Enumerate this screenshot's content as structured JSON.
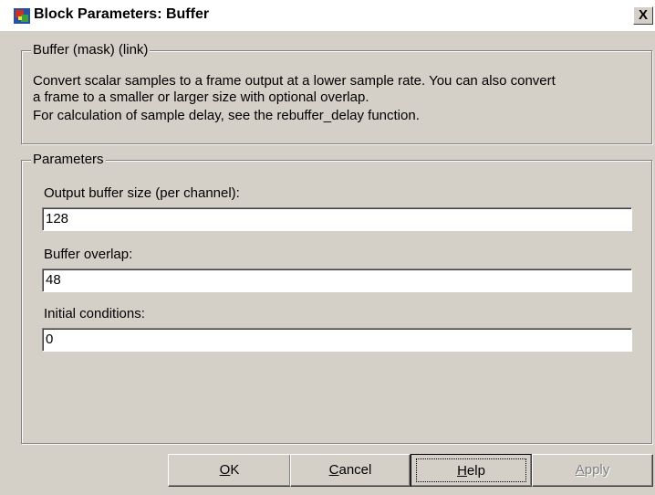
{
  "window": {
    "title": "Block Parameters: Buffer",
    "close_label": "X"
  },
  "description_group": {
    "title": "Buffer (mask) (link)",
    "lines": [
      "Convert scalar samples to a frame output at a lower sample rate.  You can also convert",
      "a frame to a smaller or larger size with optional overlap.",
      "For calculation of sample delay, see the rebuffer_delay function."
    ]
  },
  "parameters_group": {
    "title": "Parameters",
    "fields": [
      {
        "label": "Output buffer size (per channel):",
        "value": "128"
      },
      {
        "label": "Buffer overlap:",
        "value": "48"
      },
      {
        "label": "Initial conditions:",
        "value": "0"
      }
    ]
  },
  "buttons": {
    "ok": {
      "mnemonic": "O",
      "rest": "K"
    },
    "cancel": {
      "mnemonic": "C",
      "rest": "ancel"
    },
    "help": {
      "mnemonic": "H",
      "rest": "elp"
    },
    "apply": {
      "mnemonic": "A",
      "rest": "pply",
      "disabled": true
    }
  },
  "icons": {
    "app_icon": "simulink-block-icon",
    "close_icon": "close-icon"
  }
}
